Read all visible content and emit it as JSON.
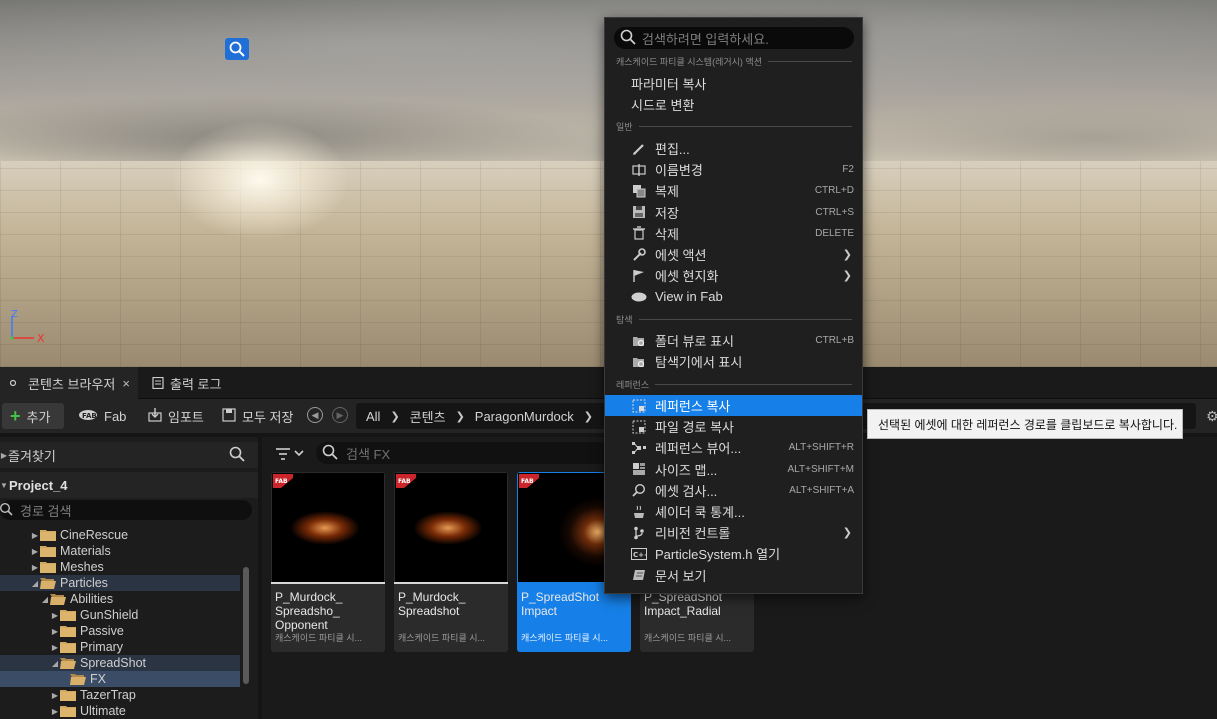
{
  "colors": {
    "accent": "#1680e8",
    "panel": "#1a1a1a",
    "menu": "#1f1f1f"
  },
  "tabs": {
    "content_browser": "콘텐츠 브라우저",
    "close": "×",
    "output_log": "출력 로그"
  },
  "toolbar": {
    "add": "추가",
    "fab": "Fab",
    "import": "임포트",
    "save_all": "모두 저장"
  },
  "breadcrumb": [
    "All",
    "콘텐츠",
    "ParagonMurdock"
  ],
  "sidebar": {
    "favorites": "즐겨찾기",
    "project": "Project_4",
    "path_search_placeholder": "경로 검색",
    "tree": [
      {
        "label": "CineRescue",
        "depth": 2,
        "expanded": false,
        "open_folder": false
      },
      {
        "label": "Materials",
        "depth": 2,
        "expanded": false,
        "open_folder": false
      },
      {
        "label": "Meshes",
        "depth": 2,
        "expanded": false,
        "open_folder": false
      },
      {
        "label": "Particles",
        "depth": 2,
        "expanded": true,
        "open_folder": true
      },
      {
        "label": "Abilities",
        "depth": 3,
        "expanded": true,
        "open_folder": true
      },
      {
        "label": "GunShield",
        "depth": 4,
        "expanded": false,
        "open_folder": false
      },
      {
        "label": "Passive",
        "depth": 4,
        "expanded": false,
        "open_folder": false
      },
      {
        "label": "Primary",
        "depth": 4,
        "expanded": false,
        "open_folder": false
      },
      {
        "label": "SpreadShot",
        "depth": 4,
        "expanded": true,
        "open_folder": true
      },
      {
        "label": "FX",
        "depth": 5,
        "expanded": null,
        "open_folder": true
      },
      {
        "label": "TazerTrap",
        "depth": 4,
        "expanded": false,
        "open_folder": false
      },
      {
        "label": "Ultimate",
        "depth": 4,
        "expanded": false,
        "open_folder": false
      }
    ]
  },
  "assets": {
    "search_placeholder": "검색 FX",
    "items": [
      {
        "name": "P_Murdock_ Spreadsho_ Opponent",
        "type": "캐스케이드 파티클 시...",
        "selected": false
      },
      {
        "name": "P_Murdock_ Spreadshot",
        "type": "캐스케이드 파티클 시...",
        "selected": false
      },
      {
        "name": "P_SpreadShot Impact",
        "type": "캐스케이드 파티클 시...",
        "selected": true
      },
      {
        "name": "P_SpreadShot Impact_Radial",
        "type": "캐스케이드 파티클 시...",
        "selected": false
      }
    ]
  },
  "menu": {
    "search_placeholder": "검색하려면 입력하세요.",
    "sections": {
      "cascade": "캐스케이드 파티클 시스템(레거시) 액션",
      "general": "일반",
      "explore": "탐색",
      "references": "레퍼런스"
    },
    "cascade_items": [
      {
        "label": "파라미터 복사"
      },
      {
        "label": "시드로 변환"
      }
    ],
    "general_items": [
      {
        "label": "편집...",
        "shortcut": "",
        "icon": "pencil-icon",
        "submenu": false
      },
      {
        "label": "이름변경",
        "shortcut": "F2",
        "icon": "rename-icon",
        "submenu": false
      },
      {
        "label": "복제",
        "shortcut": "CTRL+D",
        "icon": "duplicate-icon",
        "submenu": false
      },
      {
        "label": "저장",
        "shortcut": "CTRL+S",
        "icon": "save-icon",
        "submenu": false
      },
      {
        "label": "삭제",
        "shortcut": "DELETE",
        "icon": "trash-icon",
        "submenu": false
      },
      {
        "label": "에셋 액션",
        "shortcut": "",
        "icon": "wrench-icon",
        "submenu": true
      },
      {
        "label": "에셋 현지화",
        "shortcut": "",
        "icon": "flag-icon",
        "submenu": true
      },
      {
        "label": "View in Fab",
        "shortcut": "",
        "icon": "fab-icon",
        "submenu": false
      }
    ],
    "explore_items": [
      {
        "label": "폴더 뷰로 표시",
        "shortcut": "CTRL+B",
        "icon": "folder-search-icon"
      },
      {
        "label": "탐색기에서 표시",
        "shortcut": "",
        "icon": "explorer-icon"
      }
    ],
    "reference_items": [
      {
        "label": "레퍼런스 복사",
        "shortcut": "",
        "icon": "copy-reference-icon",
        "submenu": false,
        "hover": true
      },
      {
        "label": "파일 경로 복사",
        "shortcut": "",
        "icon": "copy-path-icon",
        "submenu": false,
        "hover": false
      },
      {
        "label": "레퍼런스 뷰어...",
        "shortcut": "ALT+SHIFT+R",
        "icon": "reference-viewer-icon",
        "submenu": false,
        "hover": false
      },
      {
        "label": "사이즈 맵...",
        "shortcut": "ALT+SHIFT+M",
        "icon": "size-map-icon",
        "submenu": false,
        "hover": false
      },
      {
        "label": "에셋 검사...",
        "shortcut": "ALT+SHIFT+A",
        "icon": "audit-icon",
        "submenu": false,
        "hover": false
      },
      {
        "label": "셰이더 쿡 통계...",
        "shortcut": "",
        "icon": "shader-icon",
        "submenu": false,
        "hover": false
      },
      {
        "label": "리비전 컨트롤",
        "shortcut": "",
        "icon": "revision-control-icon",
        "submenu": true,
        "hover": false
      },
      {
        "label": "ParticleSystem.h 열기",
        "shortcut": "",
        "icon": "cpp-icon",
        "submenu": false,
        "hover": false
      },
      {
        "label": "문서 보기",
        "shortcut": "",
        "icon": "docs-icon",
        "submenu": false,
        "hover": false
      }
    ]
  },
  "tooltip": "선택된 에셋에 대한 레퍼런스 경로를 클립보드로 복사합니다."
}
